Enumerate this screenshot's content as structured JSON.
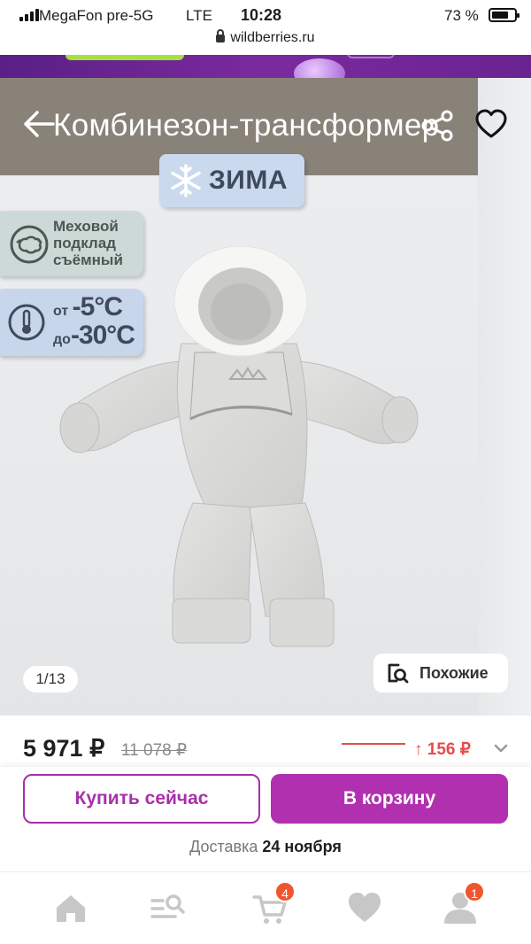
{
  "status_bar": {
    "carrier": "MegaFon pre-5G",
    "network": "LTE",
    "time": "10:28",
    "battery_percent": "73 %",
    "battery_level": 0.73,
    "url": "wildberries.ru"
  },
  "product": {
    "title": "Комбинезон-трансформер",
    "image_counter": "1/13",
    "similar_label": "Похожие",
    "badges": {
      "season": "ЗИМА",
      "fur": [
        "Меховой",
        "подклад",
        "съёмный"
      ],
      "temp_from_prefix": "от",
      "temp_from": "-5°С",
      "temp_to_prefix": "до",
      "temp_to": "-30°С"
    }
  },
  "pricing": {
    "price": "5 971 ₽",
    "old_price": "11 078 ₽",
    "price_drop": "↑ 156 ₽"
  },
  "actions": {
    "buy_now": "Купить сейчас",
    "add_to_cart": "В корзину",
    "delivery_label": "Доставка",
    "delivery_date": "24 ноября"
  },
  "tabbar": {
    "items": [
      {
        "icon": "home-icon"
      },
      {
        "icon": "catalog-search-icon"
      },
      {
        "icon": "cart-icon",
        "badge": "4"
      },
      {
        "icon": "heart-icon"
      },
      {
        "icon": "profile-icon",
        "badge": "1"
      }
    ]
  },
  "colors": {
    "brand": "#b130b0",
    "price_drop": "#e44c4c",
    "badge": "#f0562e"
  }
}
